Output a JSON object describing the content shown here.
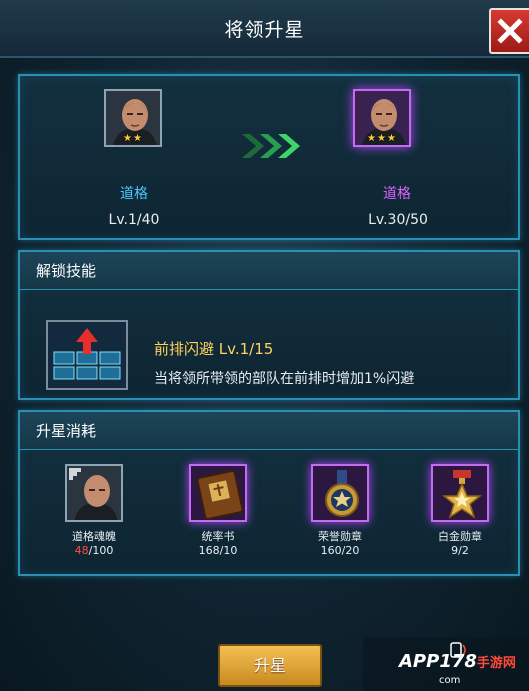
{
  "header": {
    "title": "将领升星"
  },
  "upgrade": {
    "from": {
      "name": "道格",
      "level": "Lv.1/40",
      "stars": "★★",
      "star_count": 2
    },
    "to": {
      "name": "道格",
      "level": "Lv.30/50",
      "stars": "★★★",
      "star_count": 3
    },
    "arrow_icon": "triple-chevron-right"
  },
  "skill": {
    "section_title": "解锁技能",
    "name": "前排闪避 Lv.1/15",
    "description": "当将领所带领的部队在前排时增加1%闪避"
  },
  "cost": {
    "section_title": "升星消耗",
    "items": [
      {
        "name": "道格魂魄",
        "have": "48",
        "need": "/100",
        "icon": "soul-fragment-icon"
      },
      {
        "name": "统率书",
        "have": "168",
        "need": "/10",
        "icon": "command-book-icon"
      },
      {
        "name": "荣誉勋章",
        "have": "160",
        "need": "/20",
        "icon": "honor-medal-icon"
      },
      {
        "name": "白金勋章",
        "have": "9",
        "need": "/2",
        "icon": "platinum-medal-icon"
      }
    ]
  },
  "action": {
    "label": "升星"
  },
  "watermark": {
    "text": "APP178",
    "sub": "手游网",
    "url": "com"
  },
  "colors": {
    "accent_cyan": "#2a8fb0",
    "purple_glow": "#b146ff",
    "gold": "#ffd25e",
    "red": "#ff4a3c"
  }
}
